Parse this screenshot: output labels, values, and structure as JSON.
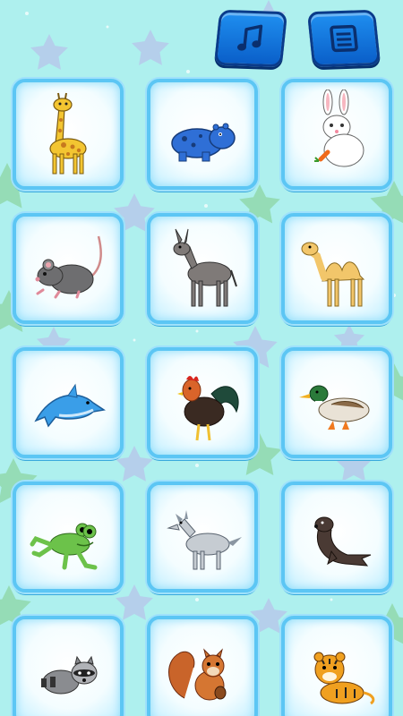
{
  "colors": {
    "background": "#aef0ee",
    "button_blue": "#1a7fe6",
    "tile_border": "#5cc6f4"
  },
  "toolbar": {
    "music_icon": "music-note-icon",
    "menu_icon": "menu-list-icon"
  },
  "animals": [
    {
      "name": "giraffe"
    },
    {
      "name": "hippo"
    },
    {
      "name": "rabbit"
    },
    {
      "name": "rat"
    },
    {
      "name": "donkey"
    },
    {
      "name": "camel"
    },
    {
      "name": "dolphin"
    },
    {
      "name": "rooster"
    },
    {
      "name": "duck"
    },
    {
      "name": "frog"
    },
    {
      "name": "wolf"
    },
    {
      "name": "seal"
    },
    {
      "name": "raccoon"
    },
    {
      "name": "squirrel"
    },
    {
      "name": "tiger"
    }
  ]
}
